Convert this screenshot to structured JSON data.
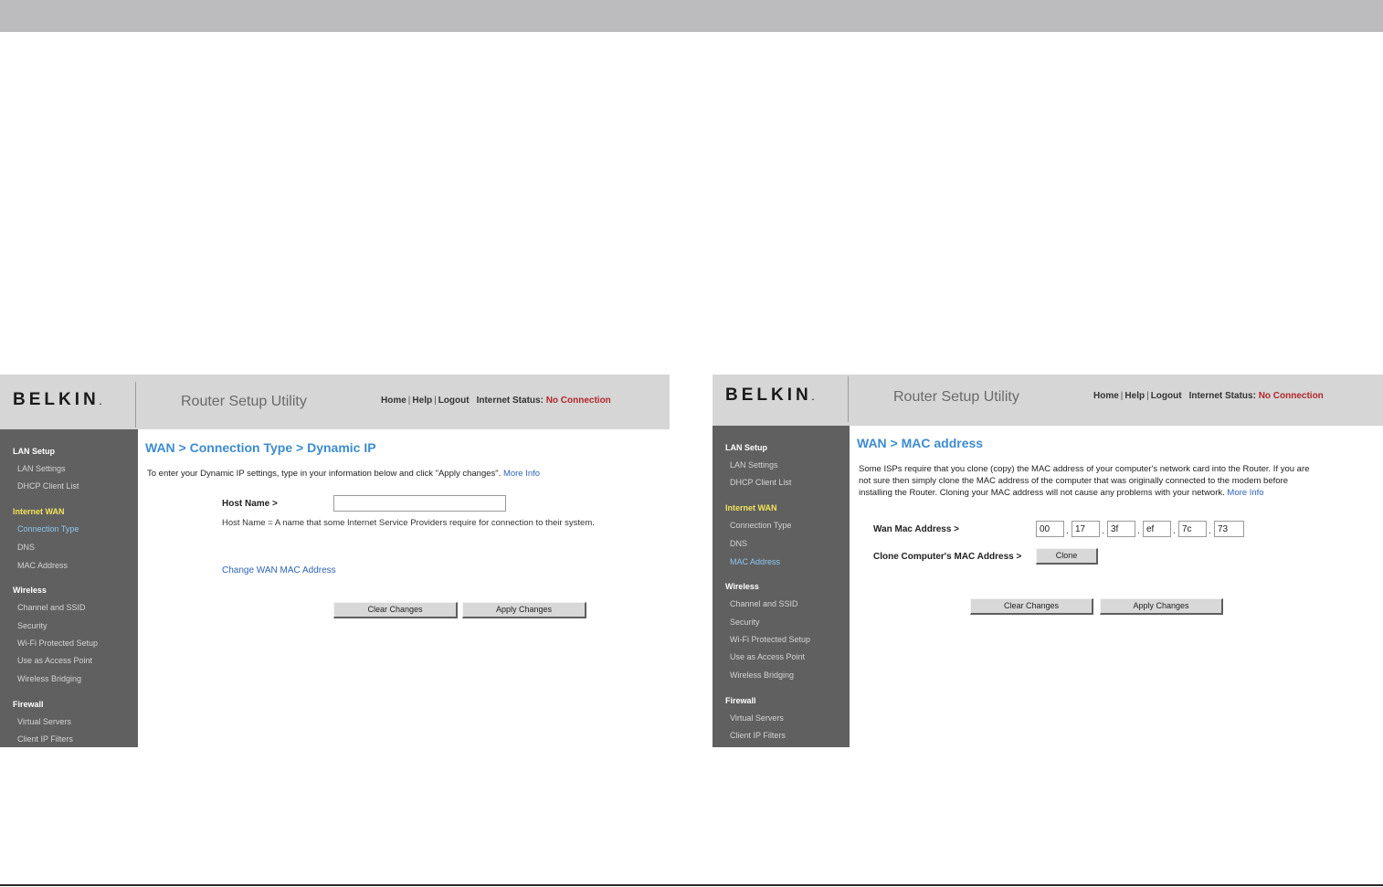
{
  "screens": [
    {
      "brand": "BELKIN",
      "app_title": "Router Setup Utility",
      "topnav": {
        "home": "Home",
        "help": "Help",
        "logout": "Logout",
        "status_label": "Internet Status:",
        "status_value": "No Connection",
        "separator": "|"
      },
      "sidebar": [
        {
          "label": "LAN Setup",
          "type": "section"
        },
        {
          "label": "LAN Settings",
          "type": "item"
        },
        {
          "label": "DHCP Client List",
          "type": "item"
        },
        {
          "label": "Internet WAN",
          "type": "section",
          "active": true
        },
        {
          "label": "Connection Type",
          "type": "item",
          "active": true
        },
        {
          "label": "DNS",
          "type": "item"
        },
        {
          "label": "MAC Address",
          "type": "item"
        },
        {
          "label": "Wireless",
          "type": "section"
        },
        {
          "label": "Channel and SSID",
          "type": "item"
        },
        {
          "label": "Security",
          "type": "item"
        },
        {
          "label": "Wi-Fi Protected Setup",
          "type": "item"
        },
        {
          "label": "Use as Access Point",
          "type": "item"
        },
        {
          "label": "Wireless Bridging",
          "type": "item"
        },
        {
          "label": "Firewall",
          "type": "section"
        },
        {
          "label": "Virtual Servers",
          "type": "item"
        },
        {
          "label": "Client IP Filters",
          "type": "item"
        }
      ],
      "page_title": "WAN > Connection Type > Dynamic IP",
      "intro": "To enter your Dynamic IP settings, type in your information below and click \"Apply changes\".",
      "more_info": "More Info",
      "host_name_label": "Host Name >",
      "host_name_value": "",
      "help_text": "Host Name = A name that some Internet Service Providers require for connection to their system.",
      "change_mac_link": "Change WAN MAC Address",
      "clear_button": "Clear Changes",
      "apply_button": "Apply Changes"
    },
    {
      "brand": "BELKIN",
      "app_title": "Router Setup Utility",
      "topnav": {
        "home": "Home",
        "help": "Help",
        "logout": "Logout",
        "status_label": "Internet Status:",
        "status_value": "No Connection",
        "separator": "|"
      },
      "sidebar": [
        {
          "label": "LAN Setup",
          "type": "section"
        },
        {
          "label": "LAN Settings",
          "type": "item"
        },
        {
          "label": "DHCP Client List",
          "type": "item"
        },
        {
          "label": "Internet WAN",
          "type": "section",
          "active": true
        },
        {
          "label": "Connection Type",
          "type": "item"
        },
        {
          "label": "DNS",
          "type": "item"
        },
        {
          "label": "MAC Address",
          "type": "item",
          "active": true
        },
        {
          "label": "Wireless",
          "type": "section"
        },
        {
          "label": "Channel and SSID",
          "type": "item"
        },
        {
          "label": "Security",
          "type": "item"
        },
        {
          "label": "Wi-Fi Protected Setup",
          "type": "item"
        },
        {
          "label": "Use as Access Point",
          "type": "item"
        },
        {
          "label": "Wireless Bridging",
          "type": "item"
        },
        {
          "label": "Firewall",
          "type": "section"
        },
        {
          "label": "Virtual Servers",
          "type": "item"
        },
        {
          "label": "Client IP Filters",
          "type": "item"
        }
      ],
      "page_title": "WAN > MAC address",
      "intro": "Some ISPs require that you clone (copy) the MAC address of your computer's network card into the Router. If you are not sure then simply clone the MAC address of the computer that was originally connected to the modem before installing the Router. Cloning your MAC address will not cause any problems with your network.",
      "more_info": "More Info",
      "wan_mac_label": "Wan Mac Address >",
      "mac_octets": [
        "00",
        "17",
        "3f",
        "ef",
        "7c",
        "73"
      ],
      "mac_separator": ".",
      "clone_label": "Clone Computer's MAC Address >",
      "clone_button": "Clone",
      "clear_button": "Clear Changes",
      "apply_button": "Apply Changes"
    }
  ],
  "colors": {
    "header_bg": "#d6d6d6",
    "sidebar_bg": "#606060",
    "title_blue": "#3d8ccf",
    "link_blue": "#2e64b8",
    "status_red": "#b3262b",
    "active_section": "#f3e35b",
    "active_item": "#8cc7ef",
    "top_band": "#bcbcbe"
  }
}
